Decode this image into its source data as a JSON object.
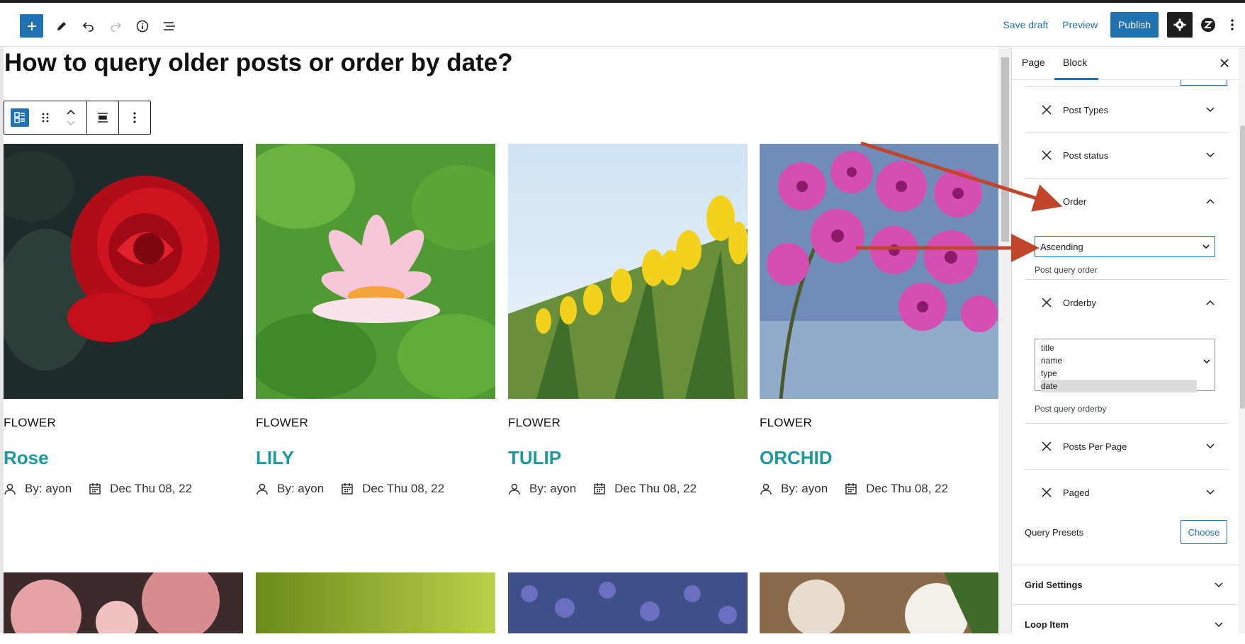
{
  "toolbar": {
    "save_draft": "Save draft",
    "preview": "Preview",
    "publish": "Publish"
  },
  "page": {
    "title": "How to query older posts or order by date?"
  },
  "cards": [
    {
      "category": "FLOWER",
      "title": "Rose",
      "author": "By: ayon",
      "date": "Dec Thu 08, 22"
    },
    {
      "category": "FLOWER",
      "title": "LILY",
      "author": "By: ayon",
      "date": "Dec Thu 08, 22"
    },
    {
      "category": "FLOWER",
      "title": "TULIP",
      "author": "By: ayon",
      "date": "Dec Thu 08, 22"
    },
    {
      "category": "FLOWER",
      "title": "ORCHID",
      "author": "By: ayon",
      "date": "Dec Thu 08, 22"
    }
  ],
  "sidebar": {
    "tabs": [
      "Page",
      "Block"
    ],
    "active_tab": "Block",
    "panels": {
      "post_types": "Post Types",
      "post_status": "Post status",
      "order": "Order",
      "orderby": "Orderby",
      "posts_per_page": "Posts Per Page",
      "paged": "Paged"
    },
    "order_value": "Ascending",
    "order_help": "Post query order",
    "orderby_options": [
      "title",
      "name",
      "type",
      "date"
    ],
    "orderby_selected": "date",
    "orderby_help": "Post query orderby",
    "query_presets": "Query Presets",
    "choose": "Choose",
    "grid_settings": "Grid Settings",
    "loop_item": "Loop Item"
  },
  "colors": {
    "accent": "#2271b1",
    "title_teal": "#1a9aa0",
    "annotation_arrow": "#c0452b"
  }
}
